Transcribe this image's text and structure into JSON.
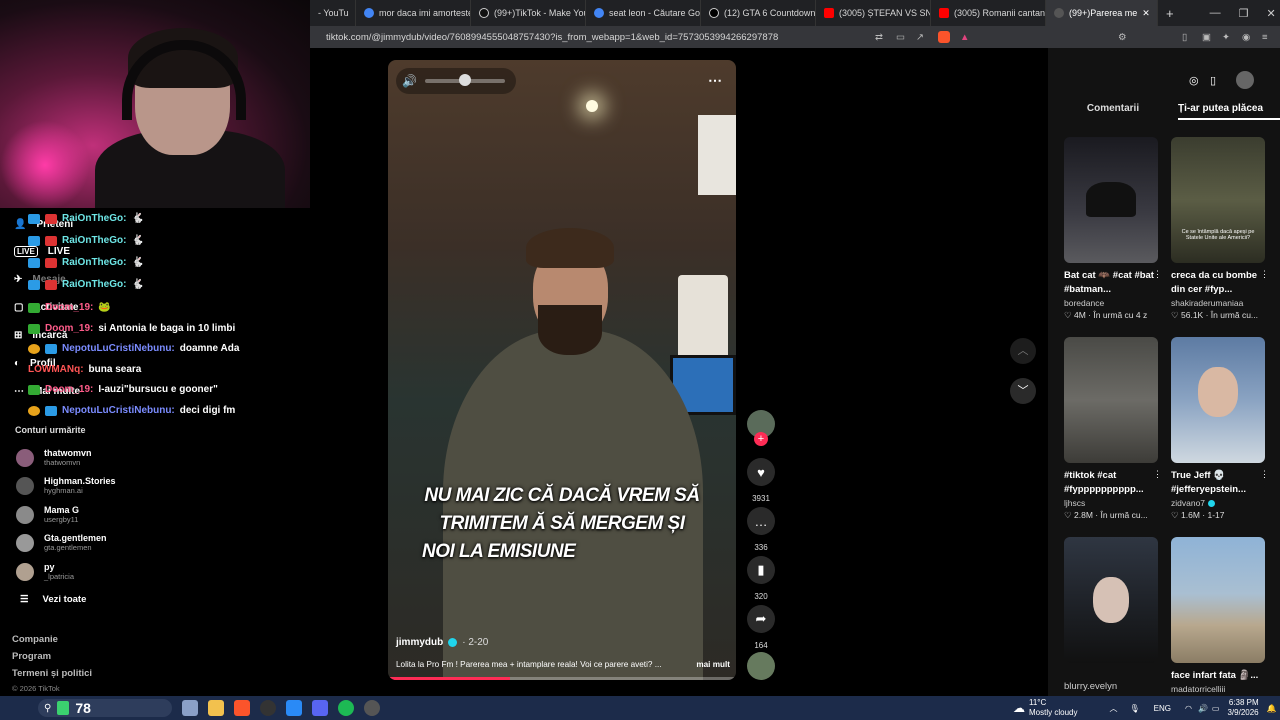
{
  "browser": {
    "tabs": [
      {
        "label": "- YouTu",
        "color": "#ff0000"
      },
      {
        "label": "mor daca imi amorteste",
        "color": "#4285f4"
      },
      {
        "label": "(99+)TikTok - Make Your",
        "color": "#111111"
      },
      {
        "label": "seat leon - Căutare Goog",
        "color": "#4285f4"
      },
      {
        "label": "(12) GTA 6 Countdown",
        "color": "#000000"
      },
      {
        "label": "(3005) ȘTEFAN VS SNIK",
        "color": "#ff0000"
      },
      {
        "label": "(3005) Romanii cantand",
        "color": "#ff0000"
      },
      {
        "label": "(99+)Parerea me",
        "color": "#111111"
      }
    ],
    "url": "tiktok.com/@jimmydub/video/7608994555048757430?is_from_webapp=1&web_id=7573053994266297878",
    "icons": [
      "tab-audio-icon",
      "close-icon",
      "new-tab-icon",
      "minimize-icon",
      "maximize-icon",
      "window-close-icon"
    ]
  },
  "sidebar": {
    "nav": [
      {
        "label": "Prieteni",
        "icon": "friends-icon"
      },
      {
        "label": "LIVE",
        "icon": "live-icon"
      },
      {
        "label": "Mesaje",
        "icon": "messages-icon"
      },
      {
        "label": "Activitate",
        "icon": "activity-icon"
      },
      {
        "label": "Încarcă",
        "icon": "upload-icon"
      },
      {
        "label": "Profil",
        "icon": "profile-icon"
      },
      {
        "label": "Mai multe",
        "icon": "more-icon"
      }
    ],
    "chat": [
      {
        "user": "RaiOnTheGo:",
        "text": "",
        "color": "#6ee6e6"
      },
      {
        "user": "RaiOnTheGo:",
        "text": "",
        "color": "#6ee6e6"
      },
      {
        "user": "RaiOnTheGo:",
        "text": "",
        "color": "#6ee6e6"
      },
      {
        "user": "RaiOnTheGo:",
        "text": "",
        "color": "#6ee6e6"
      },
      {
        "user": "Doom_19:",
        "text": "",
        "color": "#ff5c8a"
      },
      {
        "user": "Doom_19:",
        "text": "si Antonia le baga in 10 limbi",
        "color": "#ff5c8a"
      },
      {
        "user": "NepotuLuCristiNebunu:",
        "text": "doamne Ada",
        "color": "#7b8cff"
      },
      {
        "user": "LOWMANq:",
        "text": "buna seara",
        "color": "#ff5555"
      },
      {
        "user": "Doom_19:",
        "text": "I-auzi\"bursucu e gooner\"",
        "color": "#ff5c8a"
      },
      {
        "user": "NepotuLuCristiNebunu:",
        "text": "deci digi fm",
        "color": "#7b8cff"
      }
    ],
    "following_title": "Conturi urmărite",
    "accounts": [
      {
        "name": "thatwomvn",
        "handle": "thatwomvn"
      },
      {
        "name": "Highman.Stories",
        "handle": "hyghman.ai"
      },
      {
        "name": "Mama G",
        "handle": "usergby11"
      },
      {
        "name": "Gta.gentlemen",
        "handle": "gta.gentlemen"
      },
      {
        "name": "py",
        "handle": "_lpatricia"
      }
    ],
    "see_all": "Vezi toate",
    "footer": [
      "Companie",
      "Program",
      "Termeni și politici",
      "© 2026 TikTok"
    ]
  },
  "video": {
    "caption_lines": [
      "NU MAI ZIC CĂ DACĂ VREM SĂ",
      "TRIMITEM Ă SĂ MERGEM ȘI",
      "NOI LA EMISIUNE"
    ],
    "author": "jimmydub",
    "date": "· 2-20",
    "description": "Lolita la Pro Fm ! Parerea mea + intamplare reala! Voi ce parere aveti? ...",
    "more": "mai mult",
    "volume": 0.5,
    "progress": 0.35
  },
  "actions": {
    "likes": "3931",
    "comments": "336",
    "saves": "320",
    "shares": "164"
  },
  "right_panel": {
    "tabs": [
      "Comentarii",
      "Ți-ar putea plăcea"
    ],
    "cards": [
      {
        "title": "Bat cat 🦇 #cat #bat #batman...",
        "author": "boredance",
        "views": "4M",
        "time": "În urmă cu 4 z",
        "thumb": "#2c2c32"
      },
      {
        "title": "creca da cu bombe din cer #fyp...",
        "author": "shakiraderumaniaa",
        "views": "56.1K",
        "time": "În urmă cu...",
        "thumb": "#4a4a3a",
        "overlay": "Ce se întâmplă dacă apeși pe Statele Unite ale Americii?"
      },
      {
        "title": "#tiktok #cat #fypppppppppp...",
        "author": "ljhscs",
        "views": "2.8M",
        "time": "În urmă cu...",
        "thumb": "#5b5a55"
      },
      {
        "title": "True Jeff 💀 #jefferyepstein...",
        "author": "zidvano7",
        "views": "1.6M",
        "time": "1-17",
        "thumb": "#6b85a8"
      },
      {
        "title": "",
        "author": "blurry.evelyn",
        "views": "",
        "time": "",
        "thumb": "#23262b"
      },
      {
        "title": "face infart fata 🗿...",
        "author": "madatorricelliii",
        "views": "",
        "time": "",
        "thumb": "#7a8ea6"
      }
    ]
  },
  "taskbar": {
    "weather": "11°C",
    "weather_desc": "Mostly cloudy",
    "lang": "ENG",
    "time": "6:38 PM",
    "date": "3/9/2026",
    "widget_value": "78"
  }
}
